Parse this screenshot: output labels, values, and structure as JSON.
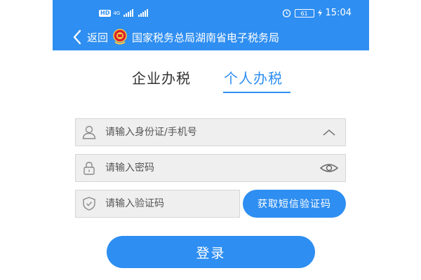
{
  "status_bar": {
    "hd_badge": "HD",
    "network": "4G",
    "battery": "61",
    "time": "15:04"
  },
  "header": {
    "back_label": "返回",
    "title": "国家税务总局湖南省电子税务局"
  },
  "tabs": [
    {
      "label": "企业办税",
      "active": false
    },
    {
      "label": "个人办税",
      "active": true
    }
  ],
  "form": {
    "id_placeholder": "请输入身份证/手机号",
    "password_placeholder": "请输入密码",
    "code_placeholder": "请输入验证码",
    "sms_button": "获取短信验证码",
    "login_button": "登录"
  },
  "icons": {
    "user": "user-icon",
    "lock": "lock-icon",
    "shield": "shield-icon",
    "chevron": "chevron-up-icon",
    "eye": "eye-icon"
  },
  "colors": {
    "accent": "#2e8ef1",
    "field_bg": "#efefef"
  }
}
